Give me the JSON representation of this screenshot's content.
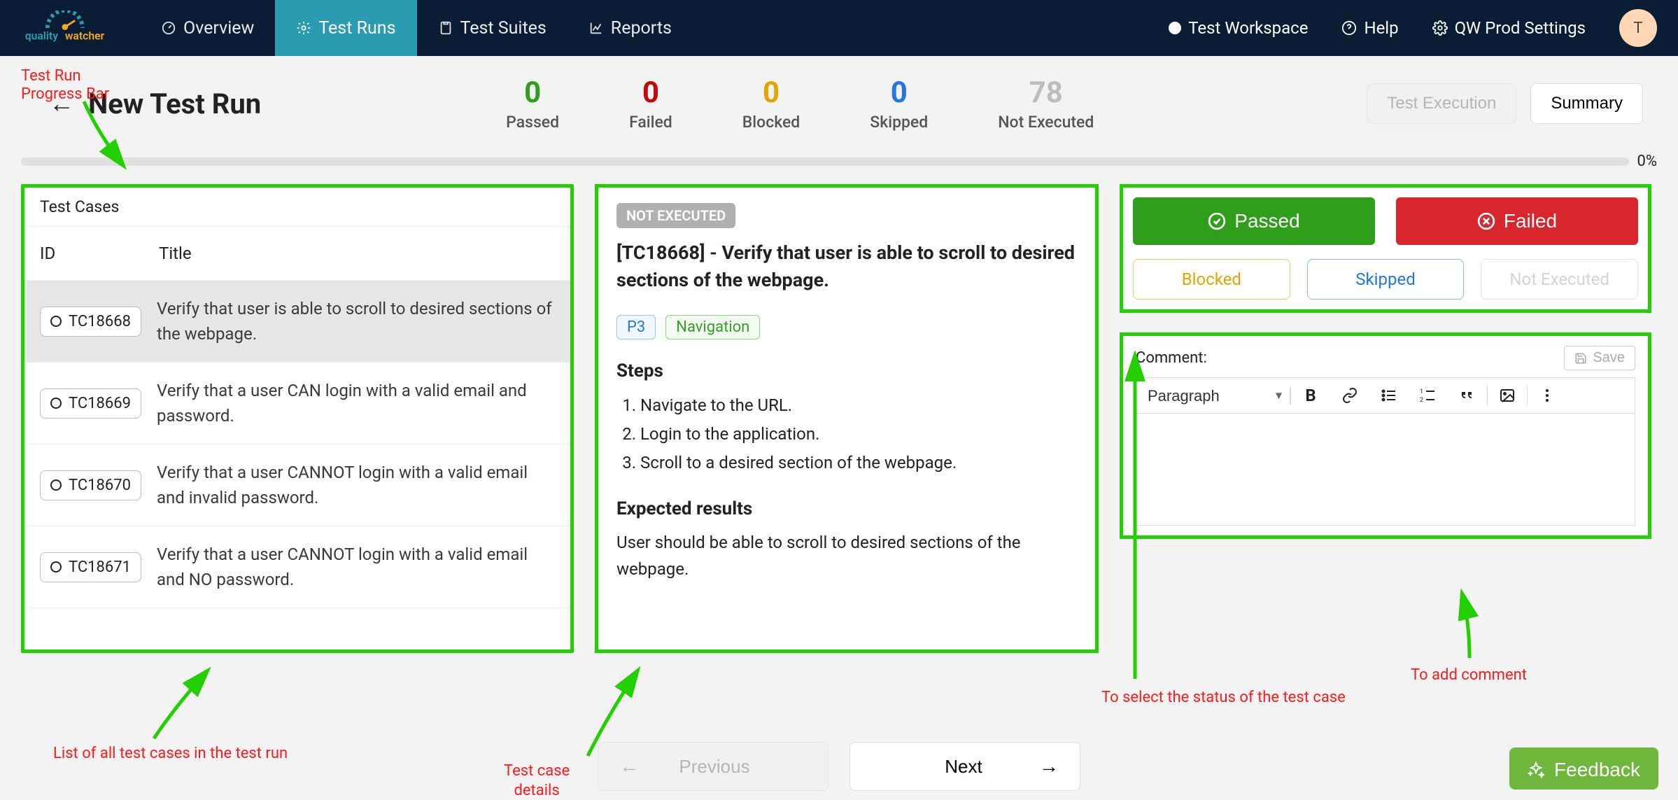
{
  "nav": {
    "items": [
      {
        "label": "Overview"
      },
      {
        "label": "Test Runs"
      },
      {
        "label": "Test Suites"
      },
      {
        "label": "Reports"
      }
    ],
    "workspace": "Test Workspace",
    "help": "Help",
    "settings": "QW Prod Settings",
    "avatar_letter": "T"
  },
  "header": {
    "title": "New Test Run",
    "test_execution_btn": "Test Execution",
    "summary_btn": "Summary"
  },
  "stats": {
    "passed": {
      "value": "0",
      "label": "Passed"
    },
    "failed": {
      "value": "0",
      "label": "Failed"
    },
    "blocked": {
      "value": "0",
      "label": "Blocked"
    },
    "skipped": {
      "value": "0",
      "label": "Skipped"
    },
    "not_exec": {
      "value": "78",
      "label": "Not Executed"
    }
  },
  "progress": {
    "pct": "0%"
  },
  "list": {
    "heading": "Test Cases",
    "col_id": "ID",
    "col_title": "Title",
    "rows": [
      {
        "id": "TC18668",
        "title": "Verify that user is able to scroll to desired sections of the webpage."
      },
      {
        "id": "TC18669",
        "title": "Verify that a user CAN login with a valid email and password."
      },
      {
        "id": "TC18670",
        "title": "Verify that a user CANNOT login with a valid email and invalid password."
      },
      {
        "id": "TC18671",
        "title": "Verify that a user CANNOT login with a valid email and NO password."
      }
    ]
  },
  "details": {
    "status_badge": "NOT EXECUTED",
    "title": "[TC18668] - Verify that user is able to scroll to desired sections of the webpage.",
    "priority": "P3",
    "tag": "Navigation",
    "steps_heading": "Steps",
    "steps": [
      "Navigate to the URL.",
      "Login to the application.",
      "Scroll to a desired section of the webpage."
    ],
    "expected_heading": "Expected results",
    "expected_text": "User should be able to scroll to desired sections of the webpage."
  },
  "status_btns": {
    "passed": "Passed",
    "failed": "Failed",
    "blocked": "Blocked",
    "skipped": "Skipped",
    "not_executed": "Not Executed"
  },
  "comment": {
    "heading": "Comment:",
    "save": "Save",
    "paragraph": "Paragraph"
  },
  "pager": {
    "previous": "Previous",
    "next": "Next"
  },
  "feedback": "Feedback",
  "annotations": {
    "progress": "Test Run\nProgress Bar",
    "list": "List of all test cases in the test run",
    "details": "Test case\ndetails",
    "status": "To select the status of the test case",
    "comment": "To add comment"
  }
}
